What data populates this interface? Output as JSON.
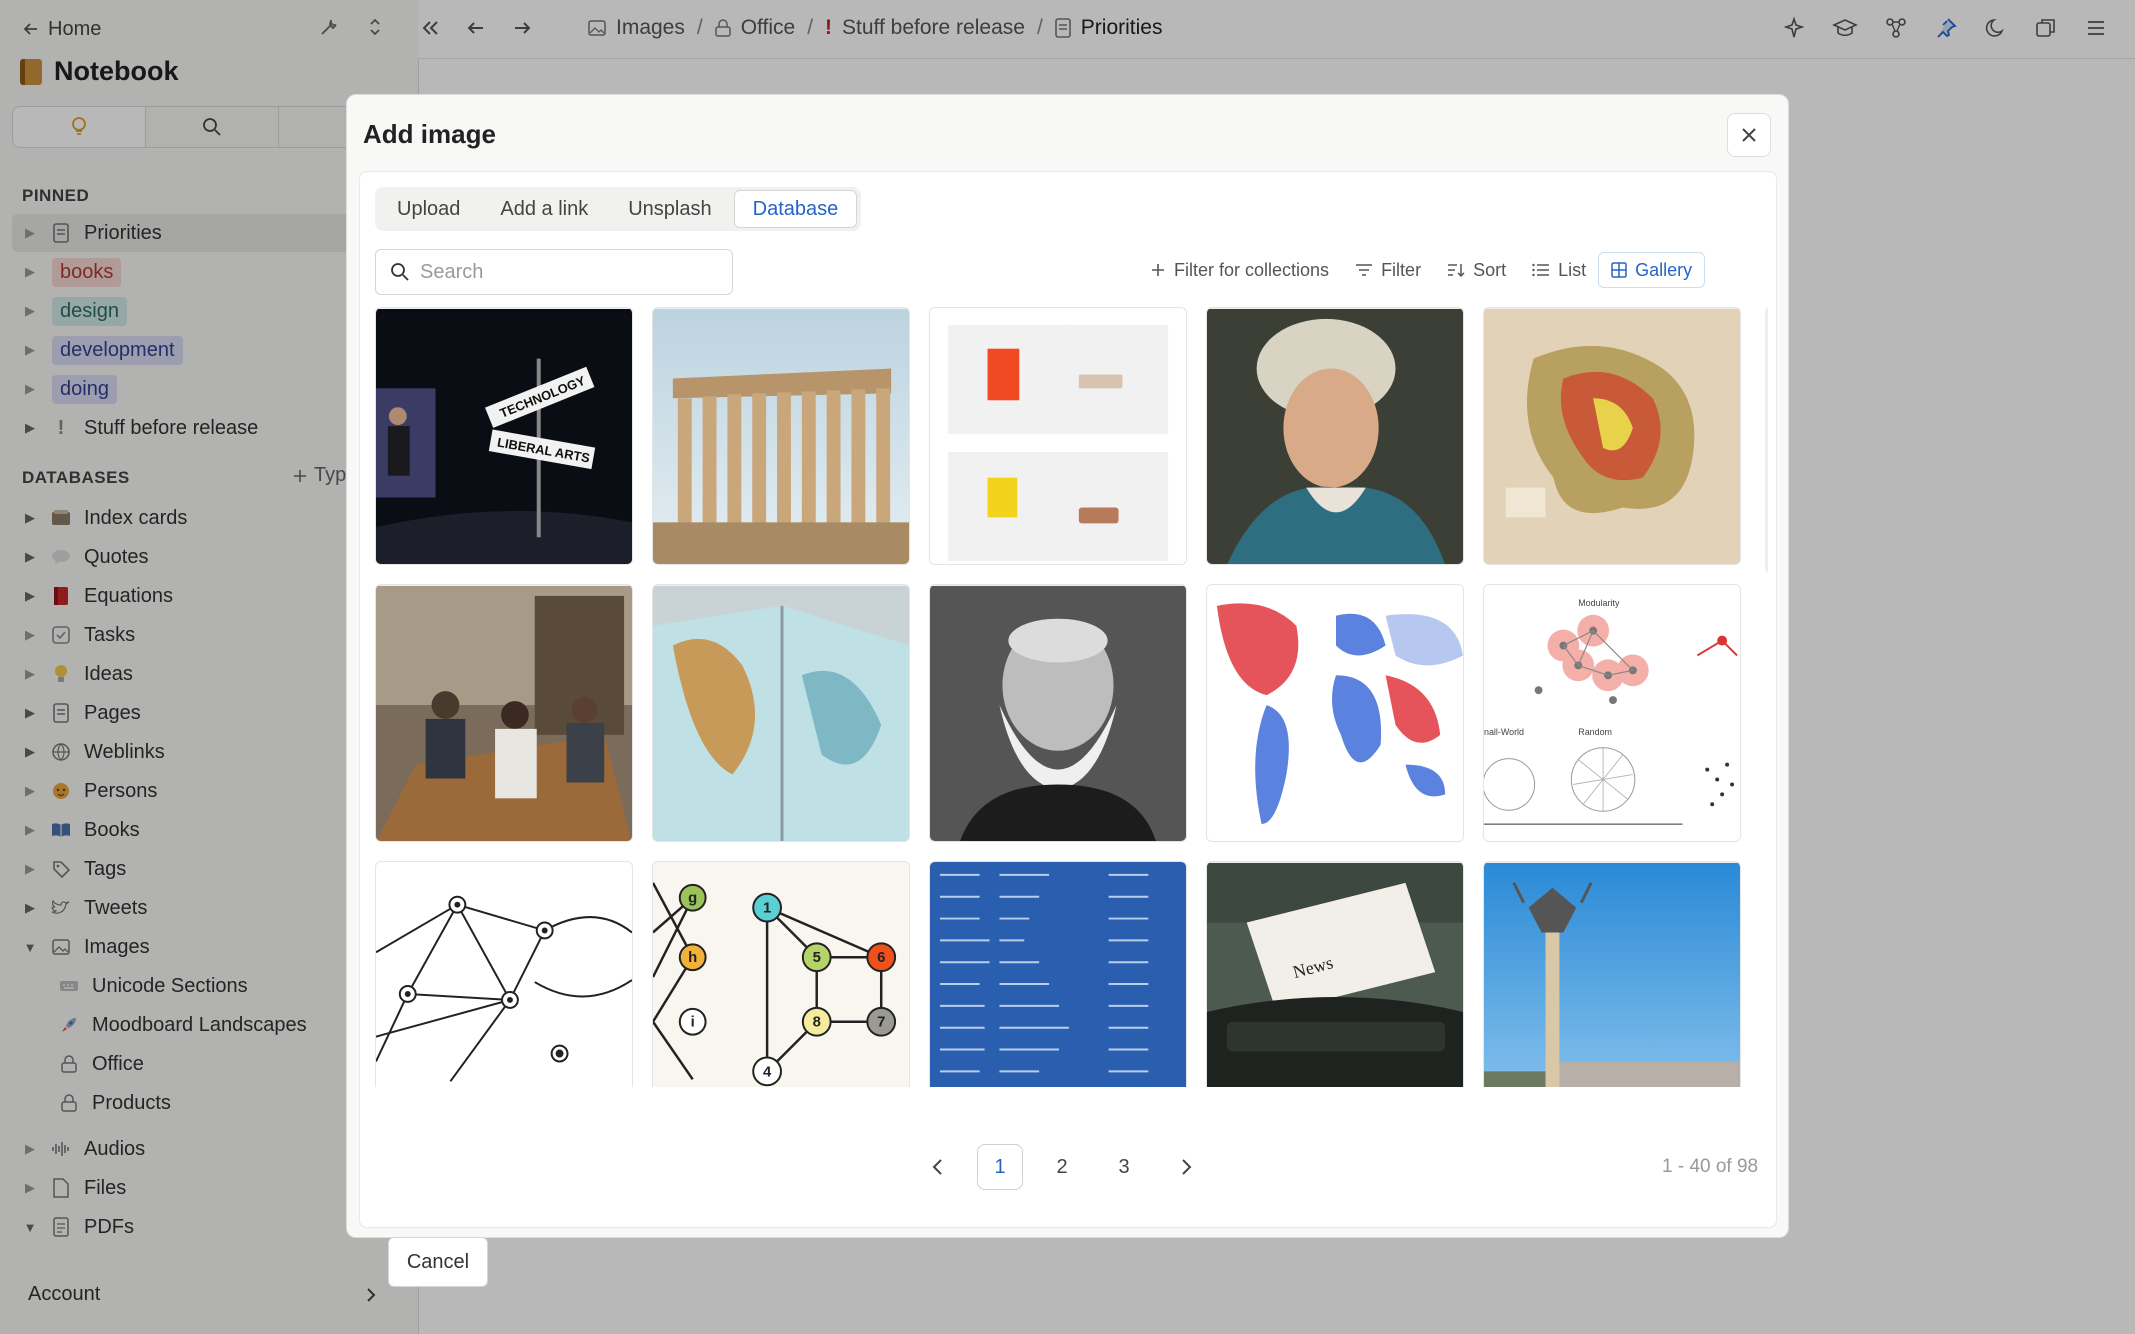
{
  "sidebar": {
    "home_label": "Home",
    "notebook_title": "Notebook",
    "pinned_label": "PINNED",
    "databases_label": "DATABASES",
    "add_type_label": "Typ",
    "pinned": [
      {
        "label": "Priorities",
        "icon": "page-icon"
      },
      {
        "label": "books",
        "tag_bg": "#f6d7d3",
        "tag_color": "#b23a2e"
      },
      {
        "label": "design",
        "tag_bg": "#cfe8e6",
        "tag_color": "#2a6b67"
      },
      {
        "label": "development",
        "tag_bg": "#d8dcf3",
        "tag_color": "#34418f"
      },
      {
        "label": "doing",
        "tag_bg": "#d8dcf3",
        "tag_color": "#34418f"
      },
      {
        "label": "Stuff before release",
        "icon": "exclamation-icon"
      }
    ],
    "databases": [
      {
        "label": "Index cards",
        "icon": "index-cards-icon"
      },
      {
        "label": "Quotes",
        "icon": "speech-bubble-icon"
      },
      {
        "label": "Equations",
        "icon": "red-book-icon"
      },
      {
        "label": "Tasks",
        "icon": "checkbox-icon"
      },
      {
        "label": "Ideas",
        "icon": "lightbulb-icon"
      },
      {
        "label": "Pages",
        "icon": "page-icon"
      },
      {
        "label": "Weblinks",
        "icon": "globe-icon"
      },
      {
        "label": "Persons",
        "icon": "person-face-icon"
      },
      {
        "label": "Books",
        "icon": "open-book-icon"
      },
      {
        "label": "Tags",
        "icon": "tag-icon"
      },
      {
        "label": "Tweets",
        "icon": "bird-icon"
      },
      {
        "label": "Images",
        "icon": "image-icon"
      },
      {
        "label": "Unicode Sections",
        "icon": "keyboard-icon"
      },
      {
        "label": "Moodboard Landscapes",
        "icon": "rocket-icon"
      },
      {
        "label": "Office",
        "icon": "lock-icon"
      },
      {
        "label": "Products",
        "icon": "lock-icon"
      },
      {
        "label": "Audios",
        "icon": "audio-wave-icon"
      },
      {
        "label": "Files",
        "icon": "file-icon"
      },
      {
        "label": "PDFs",
        "icon": "pdf-icon"
      }
    ],
    "account_label": "Account"
  },
  "breadcrumbs": [
    "Images",
    "Office",
    "Stuff before release",
    "Priorities"
  ],
  "modal": {
    "title": "Add image",
    "tabs": [
      "Upload",
      "Add a link",
      "Unsplash",
      "Database"
    ],
    "active_tab": "Database",
    "search_placeholder": "Search",
    "filter_collections_label": "Filter for collections",
    "filter_label": "Filter",
    "sort_label": "Sort",
    "list_label": "List",
    "gallery_label": "Gallery",
    "images": [
      "technology-liberal-arts-stage-photo",
      "parthenon-ruins-photo",
      "product-catalog-screenshot",
      "euler-portrait-painting",
      "relief-map-iran",
      "office-meeting-photo",
      "open-atlas-photo",
      "bearded-man-portrait-bw",
      "world-map-red-blue",
      "network-types-diagram",
      "network-graph-sketch",
      "numbered-graph-nodes",
      "equations-list-blue",
      "typewriter-news-photo",
      "city-monument-photo"
    ],
    "pages": [
      "1",
      "2",
      "3"
    ],
    "current_page": "1",
    "count_text": "1 - 40 of 98",
    "cancel_label": "Cancel"
  },
  "colors": {
    "accent": "#2563c9",
    "danger": "#d32020"
  }
}
